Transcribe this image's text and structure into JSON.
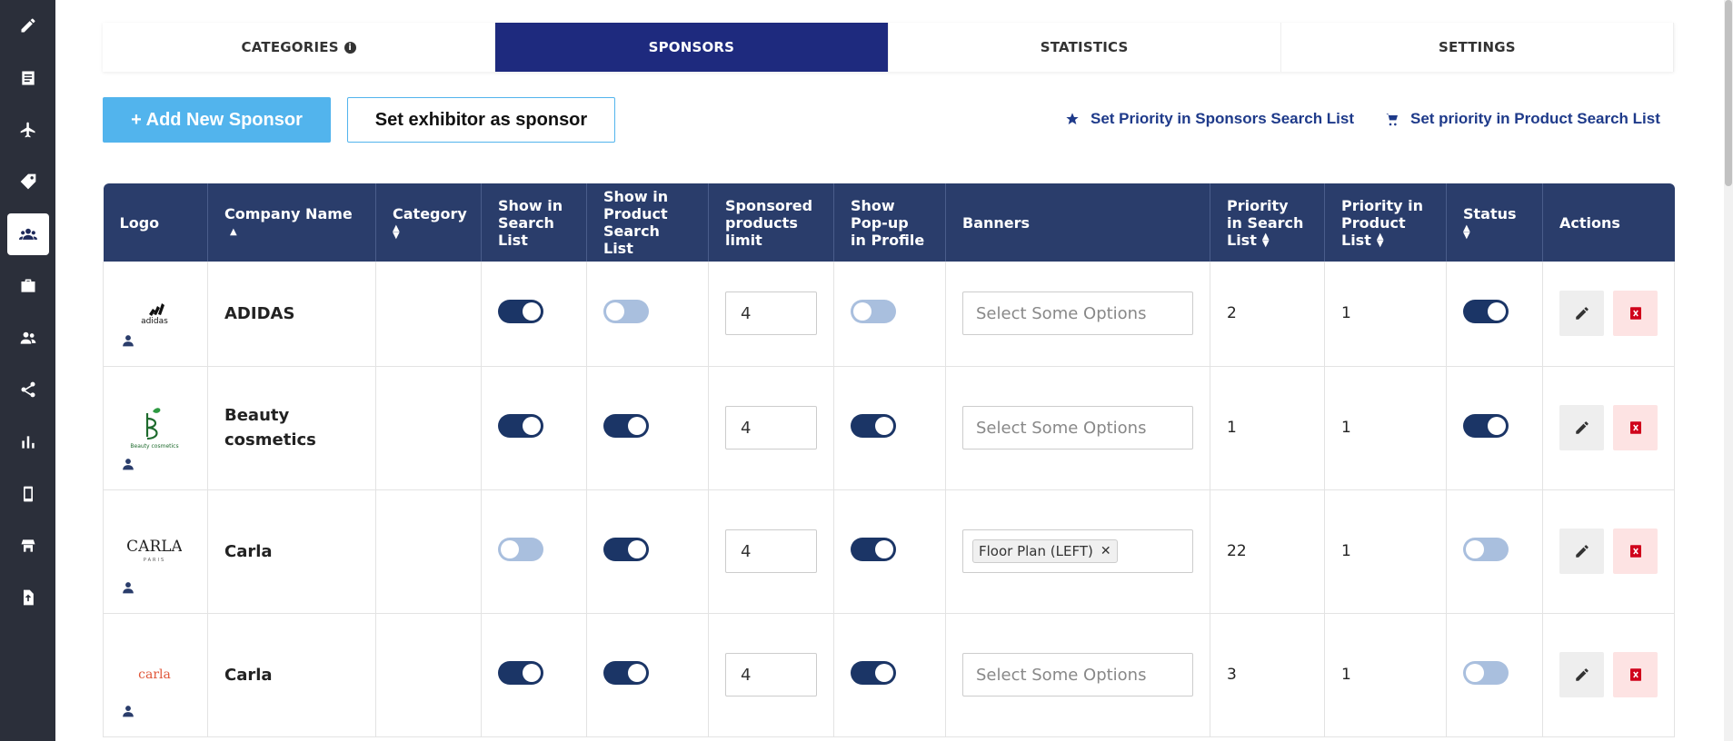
{
  "tabs": [
    {
      "label": "CATEGORIES",
      "has_info": true,
      "active": false
    },
    {
      "label": "SPONSORS",
      "active": true
    },
    {
      "label": "STATISTICS",
      "active": false
    },
    {
      "label": "SETTINGS",
      "active": false
    }
  ],
  "toolbar": {
    "add_label": "+  Add New Sponsor",
    "set_exhibitor_label": "Set exhibitor as sponsor",
    "priority_sponsors_link": "Set Priority in Sponsors Search List",
    "priority_product_link": "Set priority in Product Search List"
  },
  "table": {
    "headers": {
      "logo": "Logo",
      "company": "Company Name",
      "category": "Category",
      "show_search": "Show in Search List",
      "show_product": "Show in Product Search List",
      "sponsored_limit": "Sponsored products limit",
      "popup": "Show Pop-up in Profile",
      "banners": "Banners",
      "priority_search": "Priority in Search List",
      "priority_product": "Priority in Product List",
      "status": "Status",
      "actions": "Actions"
    },
    "rows": [
      {
        "company": "ADIDAS",
        "logo_text": "adidas",
        "category": "",
        "show_search": true,
        "show_product": false,
        "limit": "4",
        "popup": false,
        "banner": "",
        "banner_placeholder": "Select Some Options",
        "priority_search": "2",
        "priority_product": "1",
        "status": true
      },
      {
        "company": "Beauty cosmetics",
        "logo_text": "Beauty cosmetics",
        "category": "",
        "show_search": true,
        "show_product": true,
        "limit": "4",
        "popup": true,
        "banner": "",
        "banner_placeholder": "Select Some Options",
        "priority_search": "1",
        "priority_product": "1",
        "status": true
      },
      {
        "company": "Carla",
        "logo_text": "CARLA",
        "logo_sub": "PARIS",
        "category": "",
        "show_search": false,
        "show_product": true,
        "limit": "4",
        "popup": true,
        "banner": "Floor Plan (LEFT)",
        "banner_placeholder": "",
        "priority_search": "22",
        "priority_product": "1",
        "status": false
      },
      {
        "company": "Carla",
        "logo_text": "carla",
        "category": "",
        "show_search": true,
        "show_product": true,
        "limit": "4",
        "popup": true,
        "banner": "",
        "banner_placeholder": "Select Some Options",
        "priority_search": "3",
        "priority_product": "1",
        "status": false
      }
    ]
  },
  "colors": {
    "primary": "#1e2a7e",
    "header": "#2a3d6b",
    "accent": "#52b4ed",
    "toggle_on": "#1b3566",
    "toggle_off": "#a9bfde",
    "delete": "#d0021b"
  },
  "sidebar_icons": [
    "pencil-icon",
    "list-icon",
    "plane-icon",
    "tag-icon",
    "users-icon",
    "briefcase-icon",
    "people-icon",
    "share-icon",
    "chart-icon",
    "mobile-icon",
    "booth-icon",
    "upload-icon"
  ]
}
